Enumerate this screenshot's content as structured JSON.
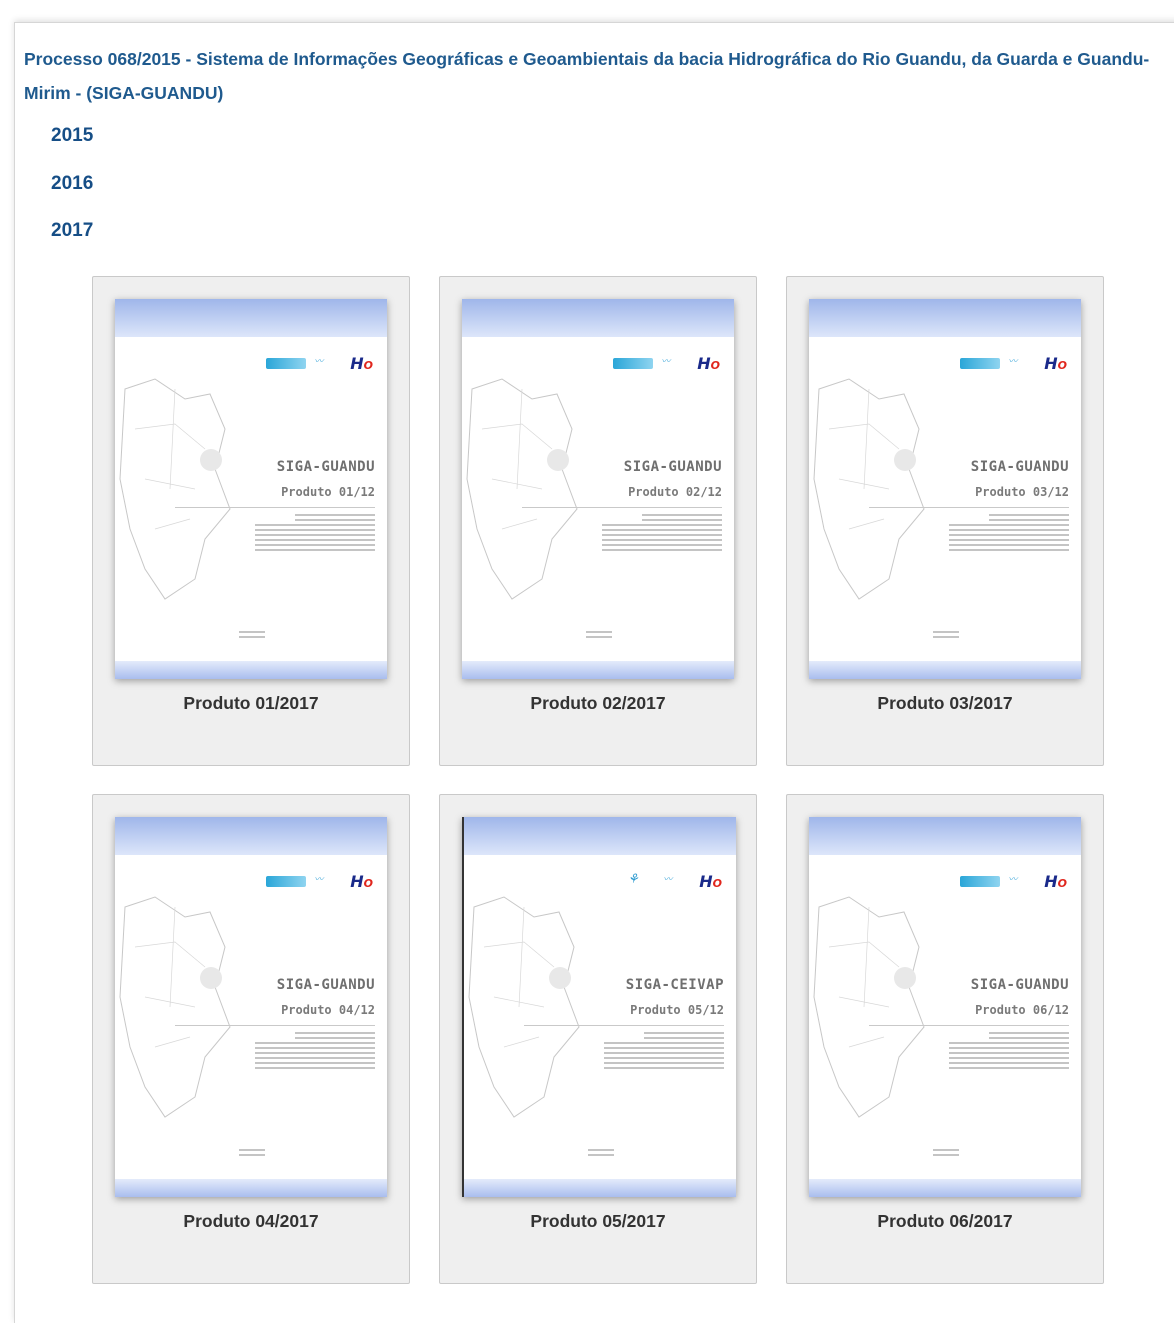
{
  "header": {
    "title_line": "Processo 068/2015 - Sistema de Informações Geográficas e Geoambientais da bacia Hidrográfica do Rio Guandu, da Guarda e Guandu-Mirim - (SIGA-GUANDU)"
  },
  "years": [
    "2015",
    "2016",
    "2017"
  ],
  "products": [
    {
      "caption": "Produto 01/2017",
      "cover_title": "SIGA-GUANDU",
      "cover_subtitle": "Produto 01/12"
    },
    {
      "caption": "Produto 02/2017",
      "cover_title": "SIGA-GUANDU",
      "cover_subtitle": "Produto 02/12"
    },
    {
      "caption": "Produto 03/2017",
      "cover_title": "SIGA-GUANDU",
      "cover_subtitle": "Produto 03/12"
    },
    {
      "caption": "Produto 04/2017",
      "cover_title": "SIGA-GUANDU",
      "cover_subtitle": "Produto 04/12"
    },
    {
      "caption": "Produto 05/2017",
      "cover_title": "SIGA-CEIVAP",
      "cover_subtitle": "Produto 05/12"
    },
    {
      "caption": "Produto 06/2017",
      "cover_title": "SIGA-GUANDU",
      "cover_subtitle": "Produto 06/12"
    }
  ],
  "colors": {
    "title": "#1f5a8e",
    "year_link": "#164e86",
    "card_bg": "#efefef",
    "cover_band": "#9fb6ea"
  }
}
